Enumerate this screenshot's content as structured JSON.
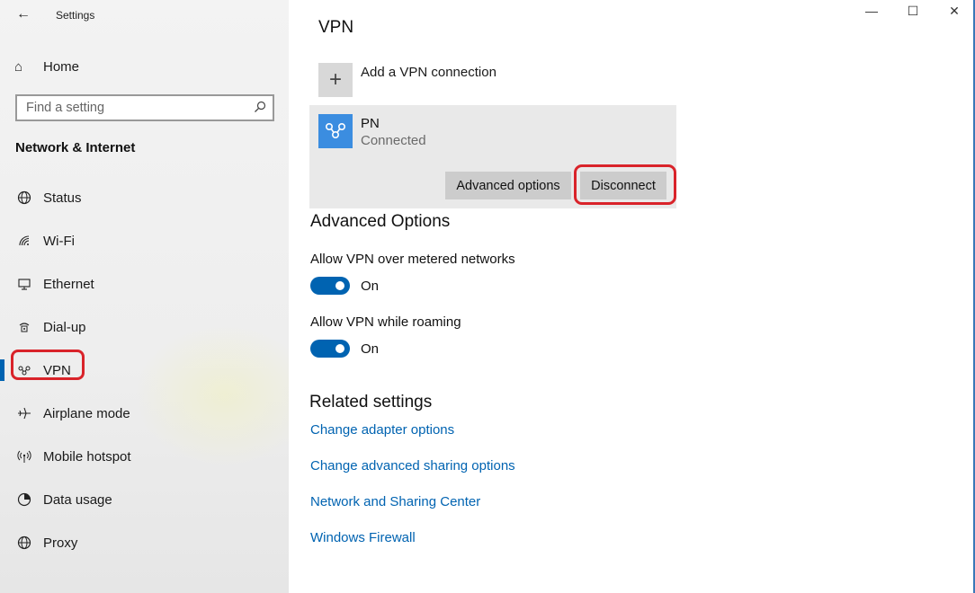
{
  "window": {
    "app_title": "Settings",
    "controls": {
      "minimize": "—",
      "maximize": "☐",
      "close": "✕"
    }
  },
  "sidebar": {
    "back_icon": "back-arrow-icon",
    "home_label": "Home",
    "search_placeholder": "Find a setting",
    "section_title": "Network & Internet",
    "items": [
      {
        "label": "Status",
        "icon": "globe-icon"
      },
      {
        "label": "Wi-Fi",
        "icon": "wifi-icon"
      },
      {
        "label": "Ethernet",
        "icon": "ethernet-icon"
      },
      {
        "label": "Dial-up",
        "icon": "dialup-icon"
      },
      {
        "label": "VPN",
        "icon": "vpn-icon",
        "active": true
      },
      {
        "label": "Airplane mode",
        "icon": "airplane-icon"
      },
      {
        "label": "Mobile hotspot",
        "icon": "hotspot-icon"
      },
      {
        "label": "Data usage",
        "icon": "data-usage-icon"
      },
      {
        "label": "Proxy",
        "icon": "globe-icon"
      }
    ]
  },
  "main": {
    "title": "VPN",
    "add_vpn_label": "Add a VPN connection",
    "connection": {
      "name": "PN",
      "status": "Connected",
      "advanced_button": "Advanced options",
      "disconnect_button": "Disconnect"
    },
    "advanced": {
      "title": "Advanced Options",
      "options": [
        {
          "label": "Allow VPN over metered networks",
          "state": "On"
        },
        {
          "label": "Allow VPN while roaming",
          "state": "On"
        }
      ]
    },
    "related": {
      "title": "Related settings",
      "links": [
        "Change adapter options",
        "Change advanced sharing options",
        "Network and Sharing Center",
        "Windows Firewall"
      ]
    }
  },
  "colors": {
    "accent": "#0063b1",
    "highlight": "#d9232a",
    "vpn_logo": "#3b8de0"
  }
}
